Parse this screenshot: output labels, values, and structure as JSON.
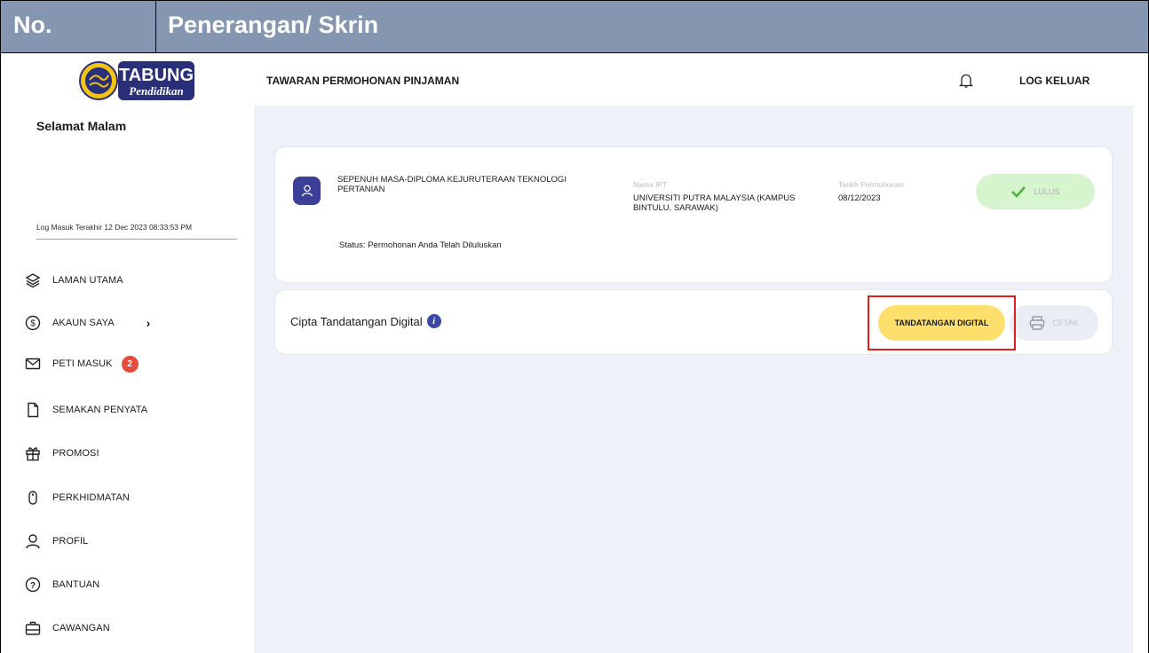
{
  "doc_header": {
    "col_no": "No.",
    "col_desc": "Penerangan/ Skrin"
  },
  "logo": {
    "line1": "TABUNG",
    "line2": "Pendidikan"
  },
  "sidebar": {
    "greeting": "Selamat Malam",
    "last_login": "Log Masuk Terakhir 12 Dec 2023 08:33:53 PM",
    "items": [
      {
        "label": "LAMAN UTAMA",
        "icon": "layers-icon"
      },
      {
        "label": "AKAUN SAYA",
        "icon": "dollar-icon",
        "chevron": "›"
      },
      {
        "label": "PETI MASUK",
        "icon": "mail-icon",
        "badge": "2"
      },
      {
        "label": "SEMAKAN PENYATA",
        "icon": "document-icon"
      },
      {
        "label": "PROMOSI",
        "icon": "gift-icon"
      },
      {
        "label": "PERKHIDMATAN",
        "icon": "mouse-icon"
      },
      {
        "label": "PROFIL",
        "icon": "user-icon"
      },
      {
        "label": "BANTUAN",
        "icon": "help-icon"
      },
      {
        "label": "CAWANGAN",
        "icon": "briefcase-icon"
      }
    ]
  },
  "topbar": {
    "title": "TAWARAN PERMOHONAN PINJAMAN",
    "logout": "LOG KELUAR"
  },
  "application": {
    "course": "SEPENUH MASA-DIPLOMA KEJURUTERAAN TEKNOLOGI PERTANIAN",
    "ipt_label": "Nama IPT",
    "ipt_value": "UNIVERSITI PUTRA MALAYSIA (KAMPUS BINTULU, SARAWAK)",
    "date_label": "Tarikh Permohonan",
    "date_value": "08/12/2023",
    "status_badge": "LULUS",
    "status_text": "Status: Permohonan Anda Telah Diluluskan"
  },
  "signature": {
    "label": "Cipta Tandatangan Digital",
    "sign_button": "TANDATANGAN DIGITAL",
    "print_button": "CETAK"
  },
  "colors": {
    "header_bg": "#8496b0",
    "content_bg": "#eef1f8",
    "accent": "#3b3f97",
    "sign_button": "#fddf6b",
    "status_pill": "#d6f5cf",
    "badge": "#e64b3c",
    "highlight": "#e01e1e"
  }
}
